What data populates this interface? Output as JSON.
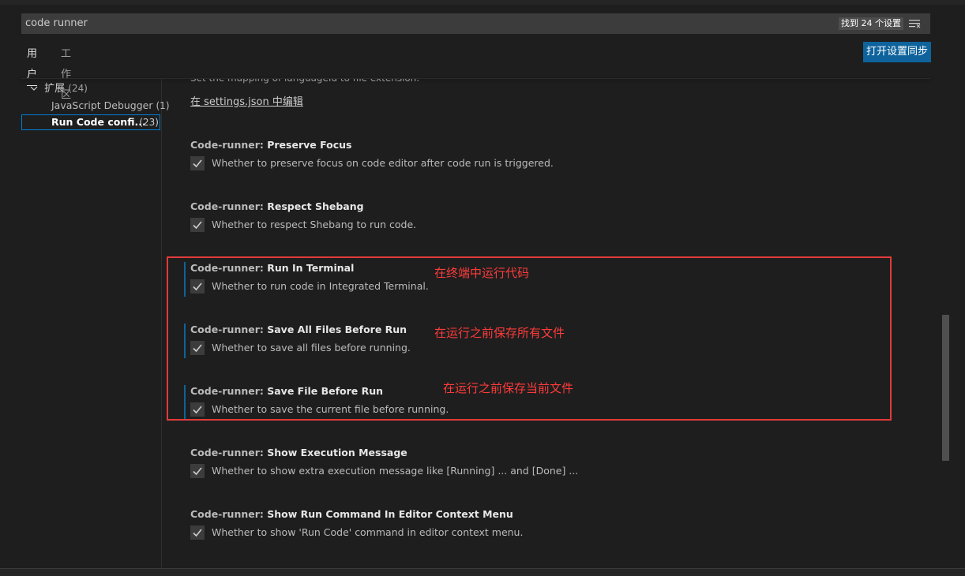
{
  "search": {
    "value": "code runner",
    "results": "找到 24 个设置"
  },
  "tabs": {
    "user": "用户",
    "workspace": "工作区"
  },
  "sync_button": "打开设置同步",
  "toc": {
    "group_label": "扩展",
    "group_count": "(24)",
    "items": [
      {
        "label": "JavaScript Debugger",
        "count": "(1)"
      },
      {
        "label": "Run Code confi...",
        "count": "(23)"
      }
    ]
  },
  "content": {
    "partial_desc": "Set the mapping of languageId to file extension.",
    "edit_link": "在 settings.json 中编辑",
    "settings": [
      {
        "category": "Code-runner: ",
        "name": "Preserve Focus",
        "desc": "Whether to preserve focus on code editor after code run is triggered.",
        "checked": true
      },
      {
        "category": "Code-runner: ",
        "name": "Respect Shebang",
        "desc": "Whether to respect Shebang to run code.",
        "checked": true
      },
      {
        "category": "Code-runner: ",
        "name": "Run In Terminal",
        "desc": "Whether to run code in Integrated Terminal.",
        "checked": true
      },
      {
        "category": "Code-runner: ",
        "name": "Save All Files Before Run",
        "desc": "Whether to save all files before running.",
        "checked": true
      },
      {
        "category": "Code-runner: ",
        "name": "Save File Before Run",
        "desc": "Whether to save the current file before running.",
        "checked": true
      },
      {
        "category": "Code-runner: ",
        "name": "Show Execution Message",
        "desc": "Whether to show extra execution message like [Running] ... and [Done] ...",
        "checked": true
      },
      {
        "category": "Code-runner: ",
        "name": "Show Run Command In Editor Context Menu",
        "desc": "Whether to show 'Run Code' command in editor context menu.",
        "checked": true
      }
    ]
  },
  "annotations": [
    "在终端中运行代码",
    "在运行之前保存所有文件",
    "在运行之前保存当前文件"
  ],
  "icons": {
    "filter": "clear-filter-icon",
    "chevron": "chevron-down-icon",
    "check": "checkmark-icon"
  },
  "colors": {
    "accent": "#0e639c",
    "annotation": "#e23a3a",
    "background": "#1e1e1e"
  }
}
